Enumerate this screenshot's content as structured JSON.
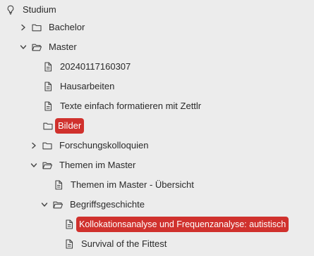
{
  "tree": {
    "items": [
      {
        "label": "Studium",
        "chevron": "none",
        "icon": "bulb-icon",
        "selected": false
      },
      {
        "label": "Bachelor",
        "chevron": "right",
        "icon": "folder-icon",
        "selected": false
      },
      {
        "label": "Master",
        "chevron": "down",
        "icon": "folder-open-icon",
        "selected": false
      },
      {
        "label": "20240117160307",
        "chevron": "none",
        "icon": "file-icon",
        "selected": false
      },
      {
        "label": "Hausarbeiten",
        "chevron": "none",
        "icon": "file-icon",
        "selected": false
      },
      {
        "label": "Texte einfach formatieren mit Zettlr",
        "chevron": "none",
        "icon": "file-icon",
        "selected": false
      },
      {
        "label": "Bilder",
        "chevron": "none",
        "icon": "folder-icon",
        "selected": true
      },
      {
        "label": "Forschungskolloquien",
        "chevron": "right",
        "icon": "folder-icon",
        "selected": false
      },
      {
        "label": "Themen im Master",
        "chevron": "down",
        "icon": "folder-open-icon",
        "selected": false
      },
      {
        "label": "Themen im Master - Übersicht",
        "chevron": "none",
        "icon": "file-icon",
        "selected": false
      },
      {
        "label": "Begriffsgeschichte",
        "chevron": "down",
        "icon": "folder-open-icon",
        "selected": false
      },
      {
        "label": "Kollokationsanalyse und Frequenzanalyse: autistisch",
        "chevron": "none",
        "icon": "file-icon",
        "selected": true
      },
      {
        "label": "Survival of the Fittest",
        "chevron": "none",
        "icon": "file-icon",
        "selected": false
      }
    ],
    "colors": {
      "background": "#ececec",
      "selection": "#d0312d",
      "text": "#2a2a2a",
      "icon": "#444444"
    }
  }
}
